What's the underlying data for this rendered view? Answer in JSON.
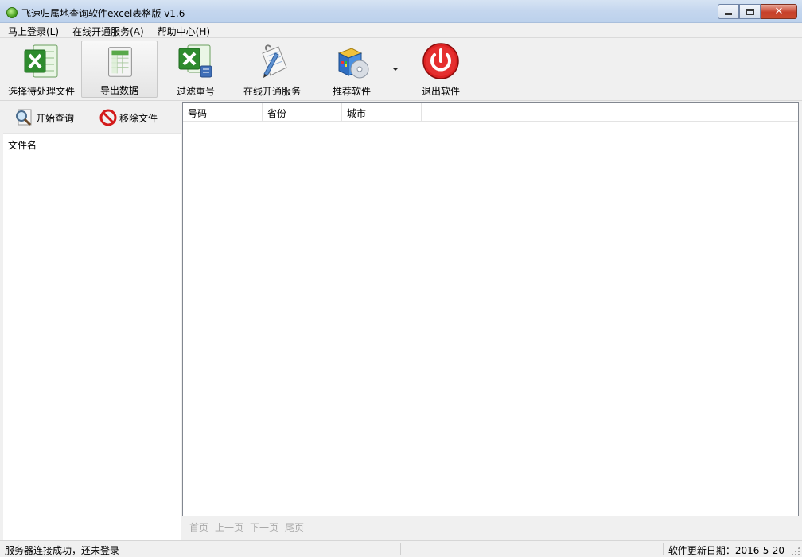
{
  "window": {
    "title": "飞速归属地查询软件excel表格版 v1.6",
    "controls": {
      "close_symbol": "✕"
    }
  },
  "menu": {
    "items": [
      {
        "label": "马上登录(L)"
      },
      {
        "label": "在线开通服务(A)"
      },
      {
        "label": "帮助中心(H)"
      }
    ]
  },
  "toolbar": {
    "buttons": [
      {
        "label": "选择待处理文件",
        "icon": "excel-file-icon"
      },
      {
        "label": "导出数据",
        "icon": "spreadsheet-export-icon"
      },
      {
        "label": "过滤重号",
        "icon": "excel-filter-icon"
      },
      {
        "label": "在线开通服务",
        "icon": "document-pen-icon"
      },
      {
        "label": "推荐软件",
        "icon": "software-box-icon"
      },
      {
        "label": "退出软件",
        "icon": "power-icon"
      }
    ]
  },
  "left_panel": {
    "start_query_label": "开始查询",
    "remove_file_label": "移除文件",
    "filelist_header": "文件名"
  },
  "grid": {
    "columns": [
      "号码",
      "省份",
      "城市"
    ]
  },
  "pager": {
    "first": "首页",
    "prev": "上一页",
    "next": "下一页",
    "last": "尾页"
  },
  "status": {
    "left": "服务器连接成功，还未登录",
    "right": "软件更新日期：2016-5-20"
  },
  "colors": {
    "titlebar": "#c4d6ee",
    "close_button": "#c7402a",
    "pager_link": "#a8a8a8"
  }
}
